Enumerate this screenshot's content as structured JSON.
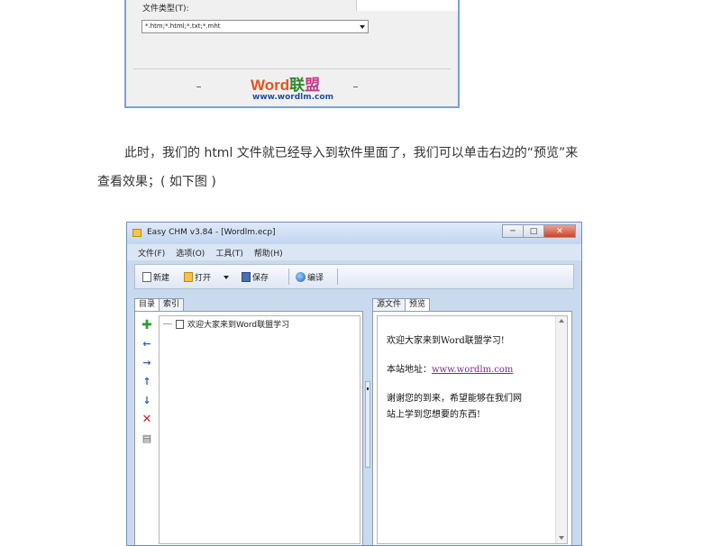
{
  "top_dialog": {
    "file_type_label": "文件类型(T):",
    "file_type_value": "*.htm;*.html;*.txt;*.mht"
  },
  "watermark": {
    "logo_word": "Word",
    "logo_cn1": "联",
    "logo_cn2": "盟",
    "url": "www.wordlm.com"
  },
  "paragraph": {
    "line1": "此时，我们的 html 文件就已经导入到软件里面了，我们可以单击右边的“预览”来",
    "line2": "查看效果；( 如下图 )"
  },
  "app": {
    "title": "Easy CHM v3.84 - [Wordlm.ecp]",
    "window_buttons": {
      "minimize": "─",
      "maximize": "□",
      "close": "✕"
    },
    "menu": [
      "文件(F)",
      "选项(O)",
      "工具(T)",
      "帮助(H)"
    ],
    "toolbar": {
      "new": "新建",
      "open": "打开",
      "save": "保存",
      "compile": "编译"
    },
    "left_tabs": [
      "目录",
      "索引"
    ],
    "tree_item": "欢迎大家来到Word联盟学习",
    "right_tabs": [
      "源文件",
      "预览"
    ],
    "preview": {
      "line1": "欢迎大家来到Word联盟学习!",
      "line2_prefix": "本站地址：",
      "line2_link": "www.wordlm.com",
      "line3": "谢谢您的到来，希望能够在我们网",
      "line4": "站上学到您想要的东西!"
    }
  },
  "colors": {
    "side_add": "#2f9a2f",
    "side_left": "#2c5fb5",
    "side_right": "#2c5fb5",
    "side_up": "#2c5fb5",
    "side_down": "#2c5fb5",
    "side_delete": "#d42020",
    "side_props": "#555555"
  }
}
